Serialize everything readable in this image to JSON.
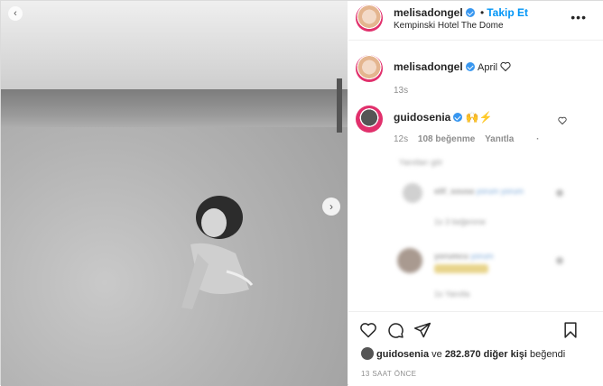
{
  "post": {
    "author": "melisadongel",
    "follow_sep": "•",
    "follow_label": "Takip Et",
    "location": "Kempinski Hotel The Dome"
  },
  "caption": {
    "author": "melisadongel",
    "text": "April",
    "time": "13s"
  },
  "comment": {
    "author": "guidosenia",
    "time": "12s",
    "likes": "108 beğenme",
    "reply": "Yanıtla"
  },
  "blurred": {
    "line1": "Yanıtları gör",
    "row1_name": "elif_sousa",
    "row1_text": "yorum yorum",
    "row1_meta": "1s  3 beğenme",
    "row2_name": "yorumcu",
    "row2_text": "yorum",
    "row2_meta": "1s  Yanıtla"
  },
  "likes": {
    "user": "guidosenia",
    "connector": "ve",
    "count": "282.870 diğer kişi",
    "verb": "beğendi"
  },
  "timestamp": "13 SAAT ÖNCE",
  "icons": {
    "like": "heart-icon",
    "comment": "comment-icon",
    "share": "paper-plane-icon",
    "save": "bookmark-icon",
    "more": "more-horizontal-icon"
  },
  "colors": {
    "accent": "#0095f6",
    "verified": "#3897f0",
    "muted": "#8e8e8e",
    "text": "#262626"
  }
}
